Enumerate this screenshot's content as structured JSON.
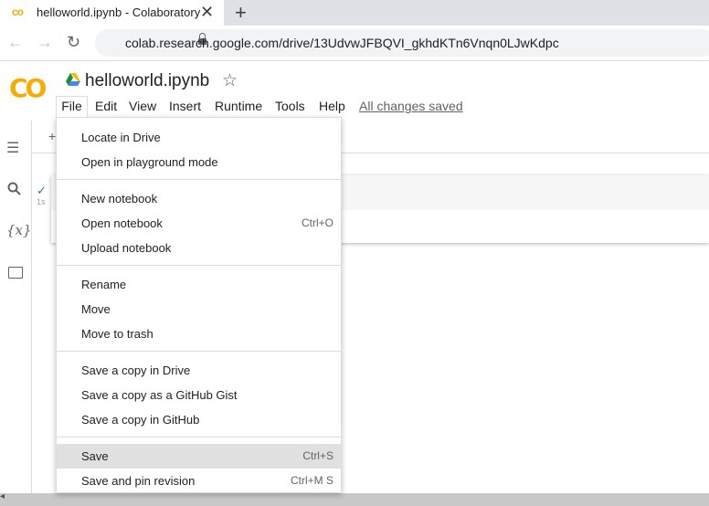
{
  "browser": {
    "tab_title": "helloworld.ipynb - Colaboratory",
    "tab_favicon": "co",
    "tab_close": "✕",
    "new_tab": "+",
    "url": "colab.research.google.com/drive/13UdvwJFBQVI_gkhdKTn6Vnqn0LJwKdpc"
  },
  "header": {
    "logo": "CO",
    "notebook_title": "helloworld.ipynb",
    "saved_status": "All changes saved"
  },
  "menubar": {
    "file": "File",
    "edit": "Edit",
    "view": "View",
    "insert": "Insert",
    "runtime": "Runtime",
    "tools": "Tools",
    "help": "Help"
  },
  "cell": {
    "exec_time": "1s"
  },
  "file_menu": {
    "items": [
      {
        "label": "Locate in Drive",
        "shortcut": ""
      },
      {
        "label": "Open in playground mode",
        "shortcut": ""
      },
      {
        "label": "New notebook",
        "shortcut": ""
      },
      {
        "label": "Open notebook",
        "shortcut": "Ctrl+O"
      },
      {
        "label": "Upload notebook",
        "shortcut": ""
      },
      {
        "label": "Rename",
        "shortcut": ""
      },
      {
        "label": "Move",
        "shortcut": ""
      },
      {
        "label": "Move to trash",
        "shortcut": ""
      },
      {
        "label": "Save a copy in Drive",
        "shortcut": ""
      },
      {
        "label": "Save a copy as a GitHub Gist",
        "shortcut": ""
      },
      {
        "label": "Save a copy in GitHub",
        "shortcut": ""
      },
      {
        "label": "Save",
        "shortcut": "Ctrl+S"
      },
      {
        "label": "Save and pin revision",
        "shortcut": "Ctrl+M S"
      }
    ],
    "highlighted": "Save"
  },
  "icons": {
    "back": "arrow-left-icon",
    "forward": "arrow-right-icon",
    "reload": "reload-icon",
    "lock": "lock-icon",
    "star": "star-icon",
    "drive": "google-drive-icon",
    "toc": "table-of-contents-icon",
    "search": "search-icon",
    "variables": "variables-icon",
    "files": "folder-icon",
    "check": "check-icon"
  },
  "colors": {
    "accent": "#f9ab00",
    "highlight": "#e0e0e0",
    "success": "#1e8e3e"
  }
}
